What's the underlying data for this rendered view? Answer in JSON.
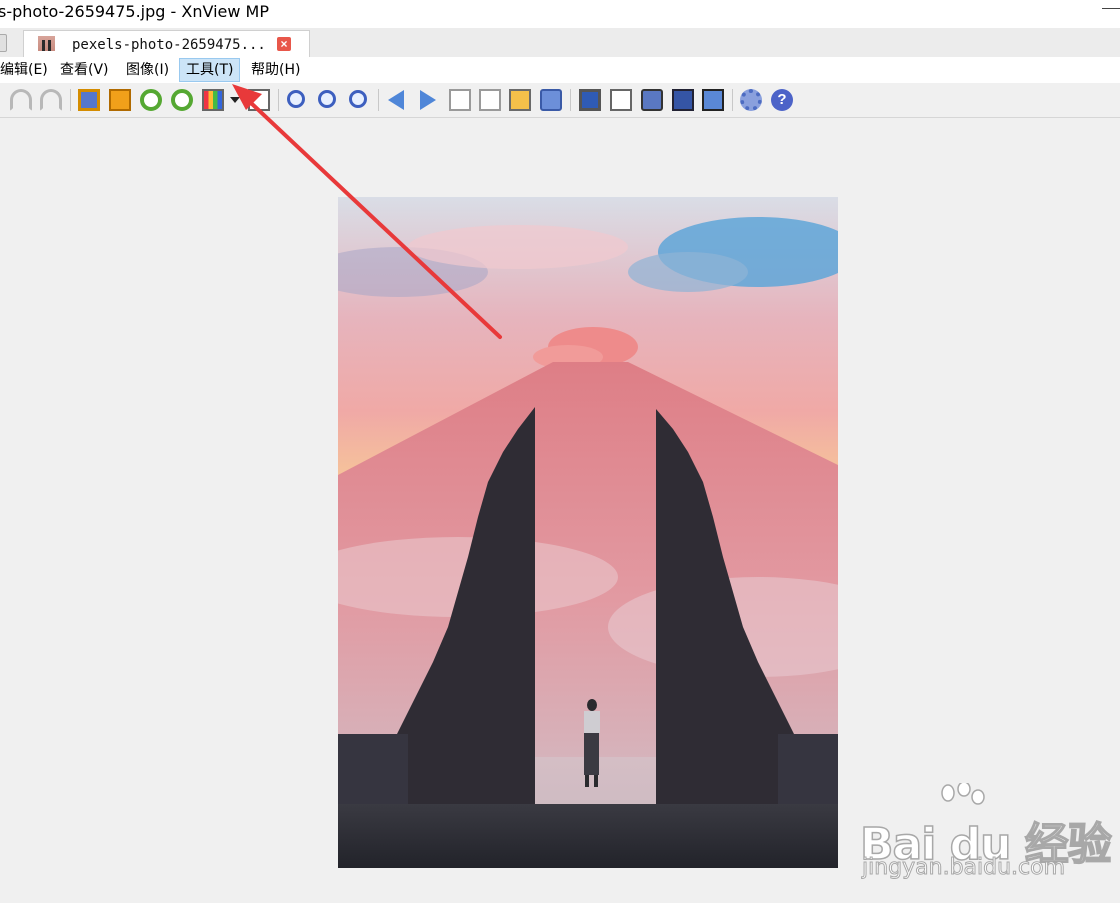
{
  "window": {
    "title": "s-photo-2659475.jpg - XnView MP"
  },
  "tabs": [
    {
      "label": "pexels-photo-2659475...",
      "close": "×"
    }
  ],
  "menu": [
    {
      "label": "编辑(E)"
    },
    {
      "label": "查看(V)"
    },
    {
      "label": "图像(I)"
    },
    {
      "label": "工具(T)"
    },
    {
      "label": "帮助(H)"
    }
  ],
  "toolbar": {
    "icons": [
      "undo-icon",
      "redo-icon",
      "crop-icon",
      "resize-icon",
      "rotate-left-icon",
      "rotate-right-icon",
      "adjust-colors-icon",
      "dropdown-arrow-icon",
      "histogram-icon",
      "zoom-in-icon",
      "zoom-fit-icon",
      "zoom-out-icon",
      "previous-icon",
      "next-icon",
      "first-page-icon",
      "last-page-icon",
      "slideshow-icon",
      "info-icon",
      "fullscreen-icon",
      "text-tool-icon",
      "print-icon",
      "scan-icon",
      "capture-icon",
      "settings-icon",
      "help-icon"
    ],
    "help_glyph": "?"
  },
  "viewer": {
    "image_subject": "temple gate with mountain at sunset"
  },
  "annotation": {
    "arrow_color": "#e8393a"
  },
  "watermark": {
    "brand": "Bai du 经验",
    "url": "jingyan.baidu.com"
  }
}
